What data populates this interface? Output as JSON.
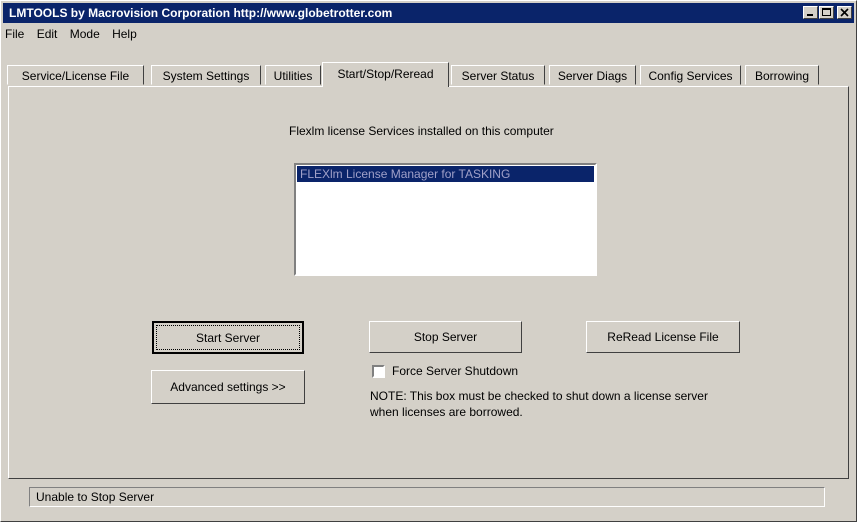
{
  "window": {
    "title": "LMTOOLS by Macrovision Corporation http://www.globetrotter.com"
  },
  "menu": [
    "File",
    "Edit",
    "Mode",
    "Help"
  ],
  "tabs": [
    {
      "label": "Service/License File"
    },
    {
      "label": "System Settings"
    },
    {
      "label": "Utilities"
    },
    {
      "label": "Start/Stop/Reread",
      "active": true
    },
    {
      "label": "Server Status"
    },
    {
      "label": "Server Diags"
    },
    {
      "label": "Config Services"
    },
    {
      "label": "Borrowing"
    }
  ],
  "panel": {
    "services_heading": "Flexlm license Services installed on this computer",
    "services": [
      "FLEXlm License Manager for TASKING"
    ],
    "start_button": "Start Server",
    "stop_button": "Stop Server",
    "reread_button": "ReRead License File",
    "advanced_button": "Advanced settings >>",
    "force_shutdown_label": "Force Server Shutdown",
    "force_shutdown_checked": false,
    "note_line1": "NOTE:  This box must be checked to shut down a license server",
    "note_line2": "when licenses are borrowed."
  },
  "status": {
    "text": "Unable to Stop Server"
  },
  "colors": {
    "titlebar": "#0a246a",
    "face": "#d4d0c8"
  }
}
